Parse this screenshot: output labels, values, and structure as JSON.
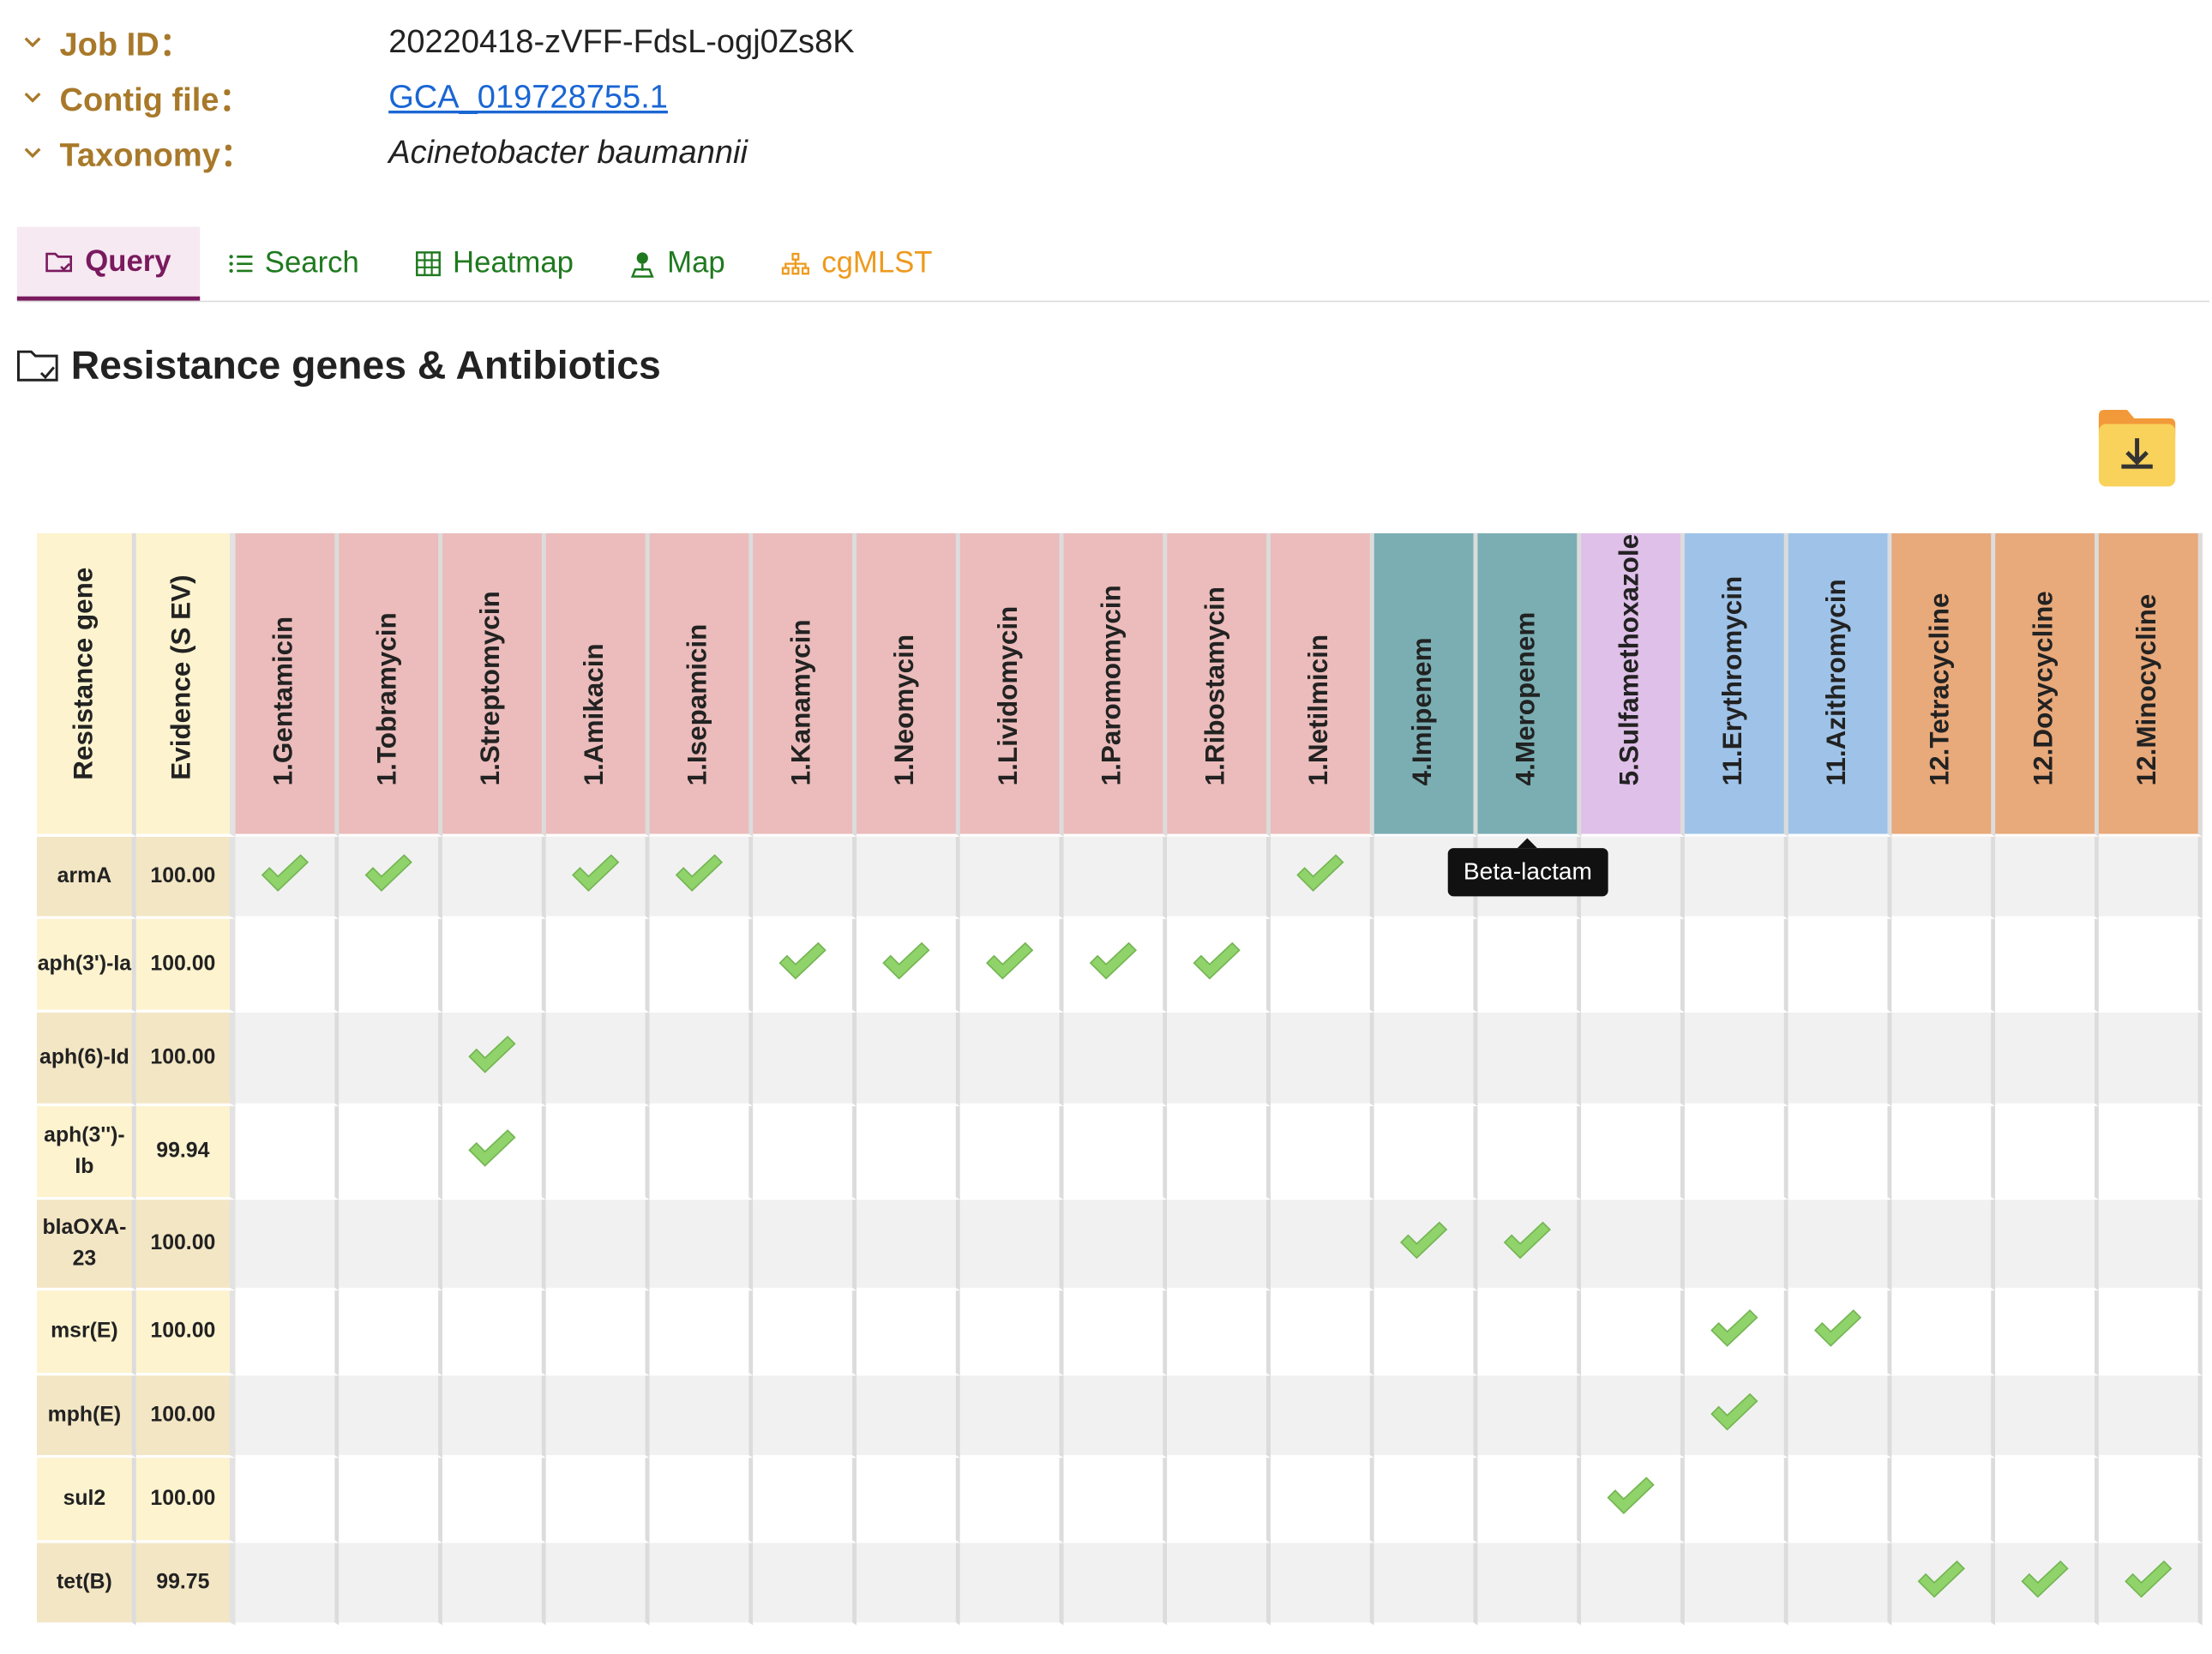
{
  "info": {
    "job_label": "Job ID：",
    "job_value": "20220418-zVFF-FdsL-ogj0Zs8K",
    "contig_label": "Contig file：",
    "contig_value": "GCA_019728755.1",
    "taxonomy_label": "Taxonomy：",
    "taxonomy_value": "Acinetobacter baumannii"
  },
  "tabs": [
    {
      "label": "Query",
      "icon": "folder-check-icon",
      "active": true
    },
    {
      "label": "Search",
      "icon": "list-icon"
    },
    {
      "label": "Heatmap",
      "icon": "grid-icon"
    },
    {
      "label": "Map",
      "icon": "map-pin-icon"
    },
    {
      "label": "cgMLST",
      "icon": "tree-icon"
    }
  ],
  "section_title": "Resistance genes & Antibiotics",
  "download_icon": "folder-download-icon",
  "table": {
    "gene_header": "Resistance gene",
    "evidence_header": "Evidence (S EV)",
    "antibiotics": [
      {
        "label": "1.Gentamicin",
        "color": "#ebbcbb"
      },
      {
        "label": "1.Tobramycin",
        "color": "#ebbcbb"
      },
      {
        "label": "1.Streptomycin",
        "color": "#ebbcbb"
      },
      {
        "label": "1.Amikacin",
        "color": "#ebbcbb"
      },
      {
        "label": "1.Isepamicin",
        "color": "#ebbcbb"
      },
      {
        "label": "1.Kanamycin",
        "color": "#ebbcbb"
      },
      {
        "label": "1.Neomycin",
        "color": "#ebbcbb"
      },
      {
        "label": "1.Lividomycin",
        "color": "#ebbcbb"
      },
      {
        "label": "1.Paromomycin",
        "color": "#ebbcbb"
      },
      {
        "label": "1.Ribostamycin",
        "color": "#ebbcbb"
      },
      {
        "label": "1.Netilmicin",
        "color": "#ebbcbb"
      },
      {
        "label": "4.Imipenem",
        "color": "#7aaeb3"
      },
      {
        "label": "4.Meropenem",
        "color": "#7aaeb3"
      },
      {
        "label": "5.Sulfamethoxazole",
        "color": "#dfc0e8"
      },
      {
        "label": "11.Erythromycin",
        "color": "#9fc3e8"
      },
      {
        "label": "11.Azithromycin",
        "color": "#9fc3e8"
      },
      {
        "label": "12.Tetracycline",
        "color": "#e8a97b"
      },
      {
        "label": "12.Doxycycline",
        "color": "#e8a97b"
      },
      {
        "label": "12.Minocycline",
        "color": "#e8a97b"
      }
    ],
    "rows": [
      {
        "gene": "armA",
        "evidence": "100.00",
        "checks": [
          0,
          1,
          3,
          4,
          10
        ]
      },
      {
        "gene": "aph(3')-Ia",
        "evidence": "100.00",
        "checks": [
          5,
          6,
          7,
          8,
          9
        ]
      },
      {
        "gene": "aph(6)-Id",
        "evidence": "100.00",
        "checks": [
          2
        ]
      },
      {
        "gene": "aph(3'')-Ib",
        "evidence": "99.94",
        "checks": [
          2
        ]
      },
      {
        "gene": "blaOXA-23",
        "evidence": "100.00",
        "checks": [
          11,
          12
        ]
      },
      {
        "gene": "msr(E)",
        "evidence": "100.00",
        "checks": [
          14,
          15
        ]
      },
      {
        "gene": "mph(E)",
        "evidence": "100.00",
        "checks": [
          14
        ]
      },
      {
        "gene": "sul2",
        "evidence": "100.00",
        "checks": [
          13
        ]
      },
      {
        "gene": "tet(B)",
        "evidence": "99.75",
        "checks": [
          16,
          17,
          18
        ]
      }
    ],
    "check_icon": "checkmark-icon",
    "check_color": "#8fd36a"
  },
  "tooltip": {
    "text": "Beta-lactam"
  }
}
